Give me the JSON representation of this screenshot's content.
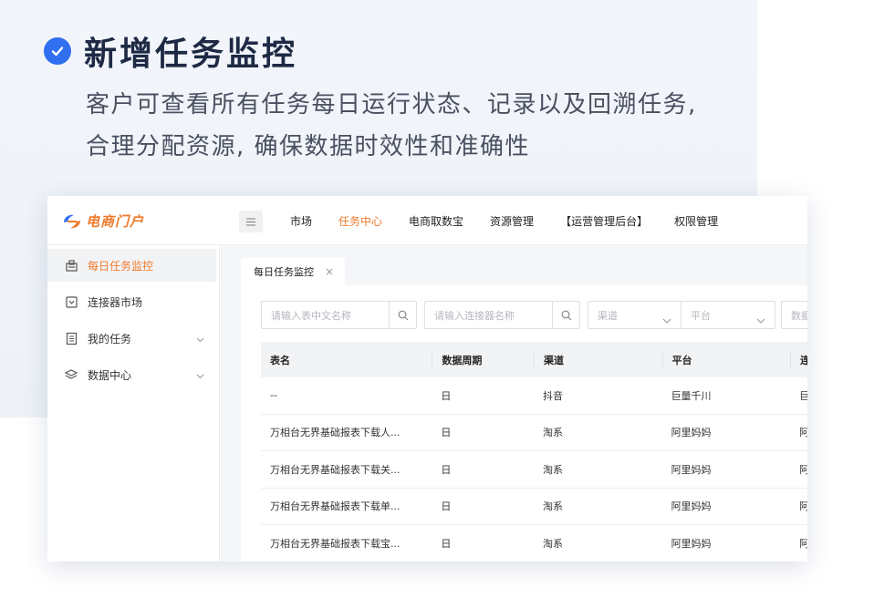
{
  "hero": {
    "title": "新增任务监控",
    "description": "客户可查看所有任务每日运行状态、记录以及回溯任务, 合理分配资源, 确保数据时效性和准确性"
  },
  "app": {
    "logo_text": "电商门户",
    "menu_icon": "menu-icon",
    "nav": [
      "市场",
      "任务中心",
      "电商取数宝",
      "资源管理",
      "【运营管理后台】",
      "权限管理"
    ],
    "nav_active": "任务中心",
    "sidebar": [
      {
        "label": "每日任务监控",
        "icon": "clipboard-icon",
        "active": true,
        "expandable": false
      },
      {
        "label": "连接器市场",
        "icon": "store-icon",
        "active": false,
        "expandable": false
      },
      {
        "label": "我的任务",
        "icon": "list-icon",
        "active": false,
        "expandable": true
      },
      {
        "label": "数据中心",
        "icon": "layers-icon",
        "active": false,
        "expandable": true
      }
    ],
    "tab": {
      "label": "每日任务监控",
      "close": "×"
    },
    "filters": {
      "table_name_placeholder": "请输入表中文名称",
      "connector_placeholder": "请输入连接器名称",
      "channel_placeholder": "渠道",
      "platform_placeholder": "平台",
      "data_placeholder": "数据"
    },
    "table": {
      "headers": [
        "表名",
        "数据周期",
        "渠道",
        "平台",
        "连"
      ],
      "rows": [
        [
          "--",
          "日",
          "抖音",
          "巨量千川",
          "巨"
        ],
        [
          "万相台无界基础报表下载人...",
          "日",
          "淘系",
          "阿里妈妈",
          "阿"
        ],
        [
          "万相台无界基础报表下载关...",
          "日",
          "淘系",
          "阿里妈妈",
          "阿"
        ],
        [
          "万相台无界基础报表下载单...",
          "日",
          "淘系",
          "阿里妈妈",
          "阿"
        ],
        [
          "万相台无界基础报表下载宝...",
          "日",
          "淘系",
          "阿里妈妈",
          "阿"
        ]
      ]
    }
  },
  "colors": {
    "accent": "#f07a2c",
    "check": "#2f6ff0",
    "title": "#1e2a45"
  }
}
